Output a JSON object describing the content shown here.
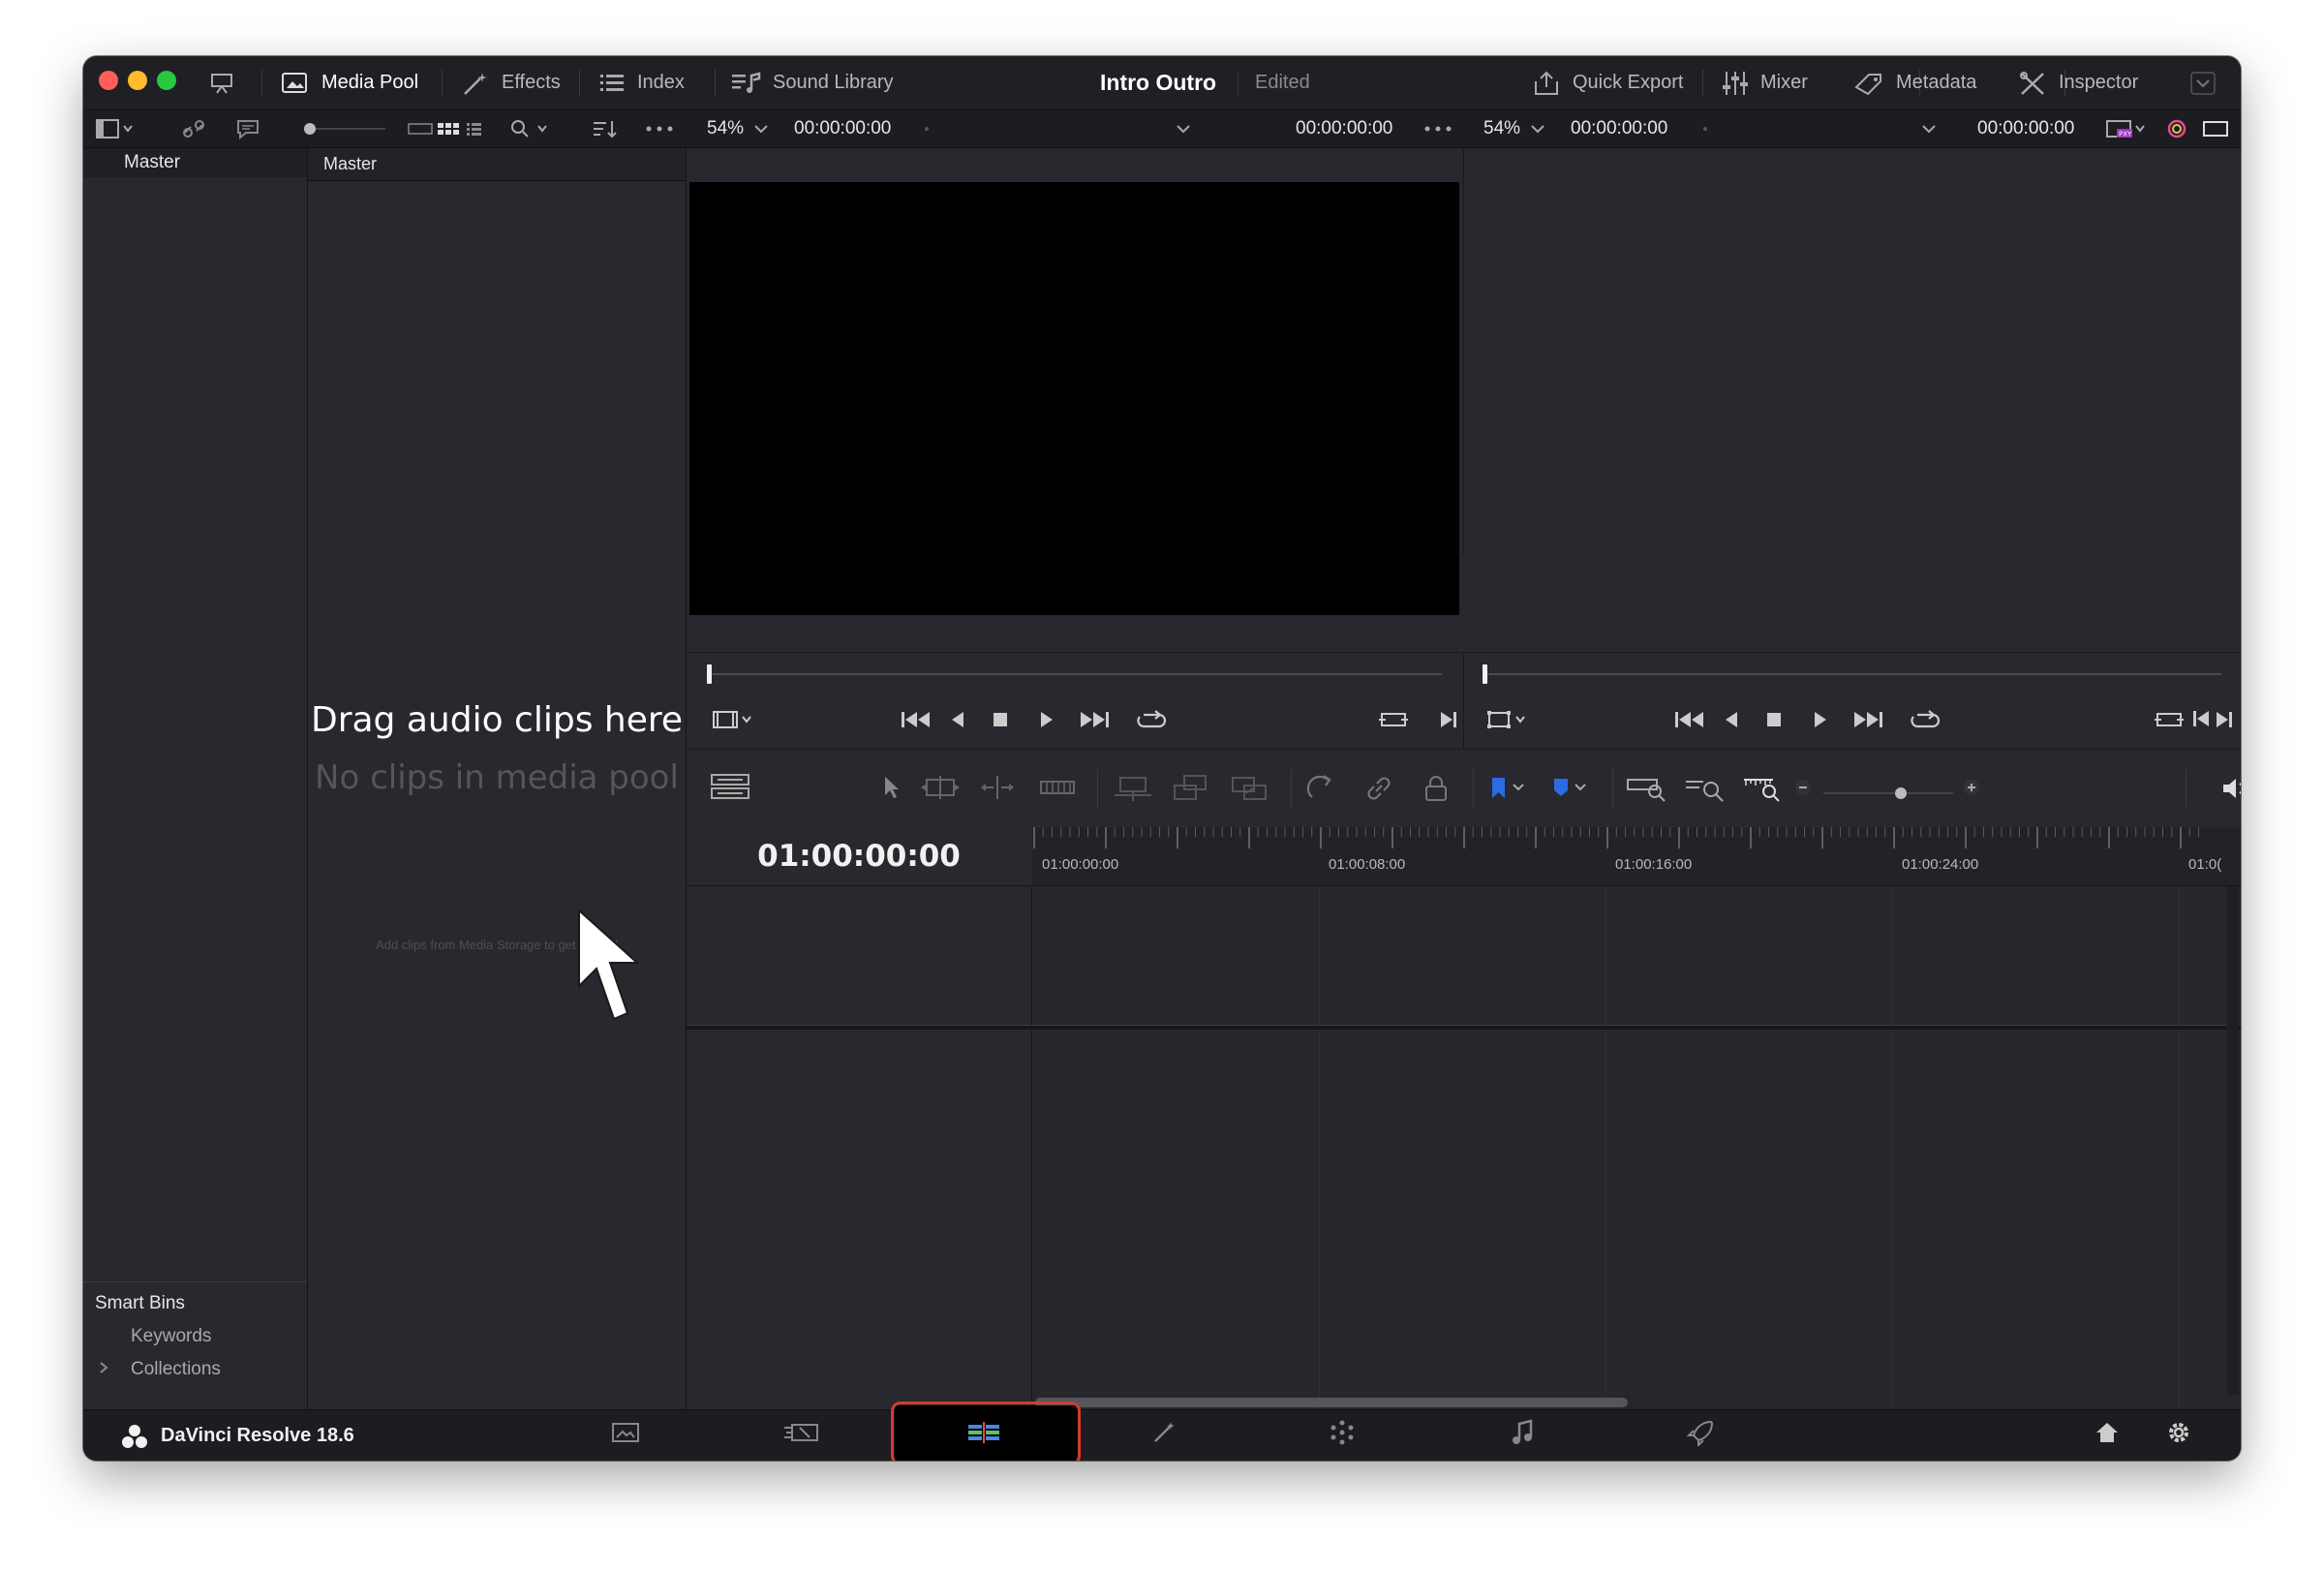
{
  "titlebar": {
    "tabs": [
      {
        "name": "media-pool",
        "label": "Media Pool"
      },
      {
        "name": "effects",
        "label": "Effects"
      },
      {
        "name": "index",
        "label": "Index"
      },
      {
        "name": "sound-library",
        "label": "Sound Library"
      }
    ],
    "project_title": "Intro Outro",
    "project_status": "Edited",
    "right_tabs": [
      {
        "name": "quick-export",
        "label": "Quick Export"
      },
      {
        "name": "mixer",
        "label": "Mixer"
      },
      {
        "name": "metadata",
        "label": "Metadata"
      },
      {
        "name": "inspector",
        "label": "Inspector"
      }
    ]
  },
  "toolbar": {
    "source_zoom": "54%",
    "source_timecode": "00:00:00:00",
    "source_duration": "00:00:00:00",
    "timeline_zoom": "54%",
    "timeline_timecode": "00:00:00:00",
    "timeline_duration": "00:00:00:00"
  },
  "bins": {
    "master": "Master",
    "smart_bins_title": "Smart Bins",
    "smart_items": [
      "Keywords",
      "Collections"
    ]
  },
  "pool": {
    "header": "Master",
    "drag_text": "Drag audio clips here",
    "no_clips_text": "No clips in media pool",
    "hint_text": "Add clips from Media Storage to get started"
  },
  "timeline": {
    "timecode": "01:00:00:00",
    "ruler_labels": [
      "01:00:00:00",
      "01:00:08:00",
      "01:00:16:00",
      "01:00:24:00",
      "01:0("
    ]
  },
  "pagebar": {
    "brand": "DaVinci Resolve 18.6",
    "pages": [
      "media-page",
      "cut-page",
      "edit-page",
      "fusion-page",
      "color-page",
      "fairlight-page",
      "deliver-page"
    ],
    "active_page": "edit-page"
  },
  "colors": {
    "accent_red": "#d43a2e",
    "marker_blue": "#2b6be3",
    "background": "#28282e"
  }
}
